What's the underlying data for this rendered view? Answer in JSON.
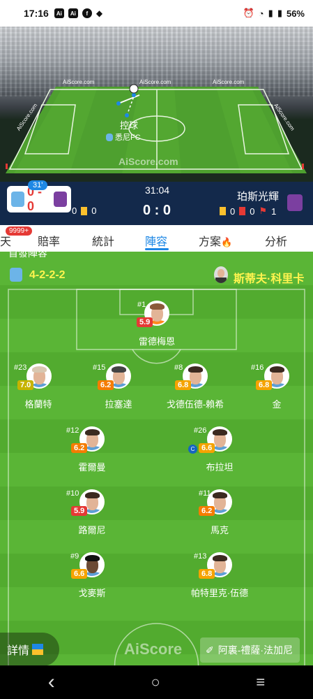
{
  "status_bar": {
    "time": "17:16",
    "app_icons": [
      "Ai",
      "Ai",
      "f",
      "◆"
    ],
    "battery": "56%"
  },
  "header": {
    "watermarks": [
      "AiScore.com",
      "AiScore.com",
      "AiScore.com",
      "AiScore.com",
      "AiScore.com"
    ],
    "field_watermark": "AiScore.com",
    "action_label": "控球",
    "action_team": "悉尼FC"
  },
  "scorebar": {
    "minute": "31'",
    "left_score": "0 - 0",
    "clock": "31:04",
    "main_score": "0 : 0",
    "away_team": "珀斯光輝",
    "home_stats": {
      "corners": "0",
      "yellow": "0"
    },
    "away_stats": {
      "yellow": "0",
      "red": "0",
      "corners": "1"
    }
  },
  "tabs": {
    "partial": "天",
    "badge": "9999+",
    "items": [
      "賠率",
      "統計",
      "陣容",
      "方案",
      "分析"
    ],
    "active": "陣容"
  },
  "lineup": {
    "section_title": "首發陣容",
    "formation": "4-2-2-2",
    "coach": "斯蒂夫·科里卡",
    "players": [
      {
        "num": "#1",
        "rating": "5.9",
        "rating_color": "#e53935",
        "name": "雷德梅恩"
      },
      {
        "num": "#23",
        "rating": "7.0",
        "rating_color": "#c6b300",
        "name": "格蘭特"
      },
      {
        "num": "#15",
        "rating": "6.2",
        "rating_color": "#f57c00",
        "name": "拉塞達"
      },
      {
        "num": "#8",
        "rating": "6.8",
        "rating_color": "#f5a300",
        "name": "戈德伍德-賴希"
      },
      {
        "num": "#16",
        "rating": "6.8",
        "rating_color": "#f5a300",
        "name": "金"
      },
      {
        "num": "#12",
        "rating": "6.2",
        "rating_color": "#f57c00",
        "name": "霍爾曼"
      },
      {
        "num": "#26",
        "rating": "6.6",
        "rating_color": "#f5a300",
        "name": "布拉坦",
        "captain": "C"
      },
      {
        "num": "#10",
        "rating": "5.9",
        "rating_color": "#e53935",
        "name": "路爾尼"
      },
      {
        "num": "#11",
        "rating": "6.2",
        "rating_color": "#f57c00",
        "name": "馬克"
      },
      {
        "num": "#9",
        "rating": "6.6",
        "rating_color": "#f5a300",
        "name": "戈麥斯"
      },
      {
        "num": "#13",
        "rating": "6.8",
        "rating_color": "#f5a300",
        "name": "帕特里克·伍德"
      }
    ]
  },
  "footer": {
    "details": "詳情",
    "referee": "阿裏-禮薩·法加尼",
    "watermark": "AiScore"
  },
  "navbar": {
    "back": "‹",
    "home": "○",
    "recents": "≡"
  }
}
